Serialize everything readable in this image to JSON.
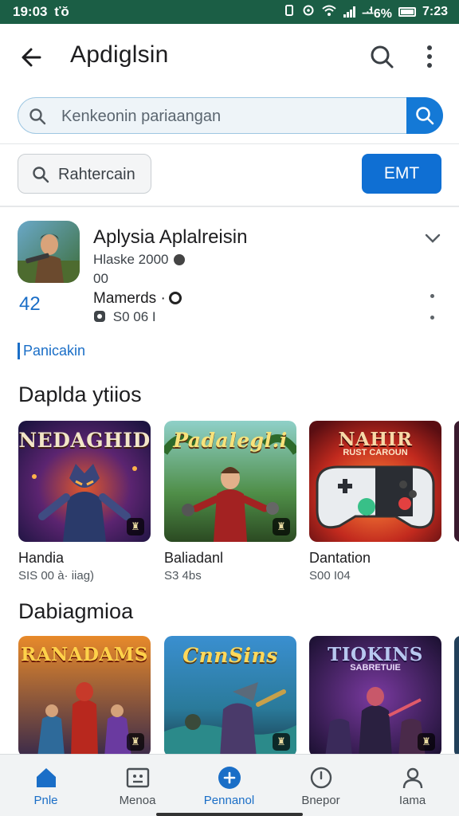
{
  "status_bar": {
    "time": "19:03",
    "carrier_mark": "ťŏ",
    "battery_text": "ᅺ6%",
    "clock_right": "7:23"
  },
  "app_bar": {
    "title": "Apdiglsin"
  },
  "search": {
    "placeholder": "Kenkeonin pariaangan"
  },
  "filter": {
    "chip_label": "Rahtercain",
    "button_label": "EMT"
  },
  "app_detail": {
    "title": "Aplysia Aplalreisin",
    "meta_line1": "Hlaske 2000",
    "meta_line2": "00",
    "rating": "42",
    "developer": "Mamerds ·",
    "size": "S0 06 I",
    "link": "Panicakin"
  },
  "sections": [
    {
      "title": "Daplda ytiios",
      "cards": [
        {
          "thumb_title": "NEDAGHID",
          "name": "Handia",
          "sub": "SIS 00 à· iiag)"
        },
        {
          "thumb_title": "Padalegl.i",
          "name": "Baliadanl",
          "sub": "S3 4bs"
        },
        {
          "thumb_title": "NAHIR",
          "thumb_subtitle": "RUST CAROUN",
          "name": "Dantation",
          "sub": "S00 I04"
        }
      ]
    },
    {
      "title": "Dabiagmioa",
      "cards": [
        {
          "thumb_title": "RANADAMS",
          "name": "",
          "sub": ""
        },
        {
          "thumb_title": "CnnSins",
          "name": "",
          "sub": ""
        },
        {
          "thumb_title": "TIOKINS",
          "thumb_subtitle": "SABRETUIE",
          "name": "",
          "sub": ""
        }
      ]
    }
  ],
  "bottom_nav": [
    {
      "label": "Pnle",
      "icon": "home-icon",
      "active": true
    },
    {
      "label": "Menoa",
      "icon": "media-icon",
      "active": false
    },
    {
      "label": "Pennanol",
      "icon": "add-icon",
      "active": true
    },
    {
      "label": "Bnepor",
      "icon": "clock-icon",
      "active": false
    },
    {
      "label": "Iama",
      "icon": "person-icon",
      "active": false
    }
  ],
  "colors": {
    "status_bar": "#1b5e45",
    "accent": "#1479d6",
    "rating": "#1a6ec7"
  }
}
